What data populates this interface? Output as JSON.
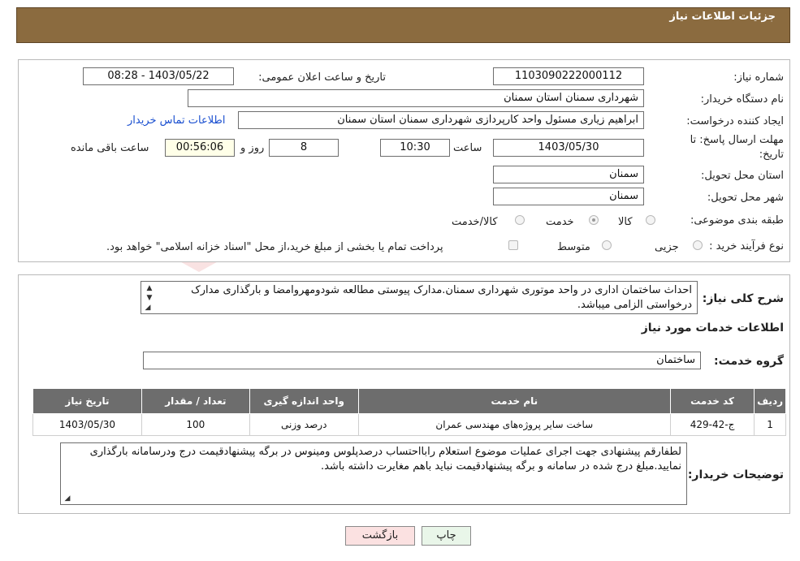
{
  "header": {
    "title": "جزئیات اطلاعات نیاز"
  },
  "fields": {
    "need_number_label": "شماره نیاز:",
    "need_number": "1103090222000112",
    "announce_label": "تاریخ و ساعت اعلان عمومی:",
    "announce_value": "1403/05/22 - 08:28",
    "buyer_org_label": "نام دستگاه خریدار:",
    "buyer_org": "شهرداری سمنان استان سمنان",
    "creator_label": "ایجاد کننده درخواست:",
    "creator": "ابراهیم زیاری مسئول واحد کارپردازی شهرداری سمنان استان سمنان",
    "contact_link": "اطلاعات تماس خریدار",
    "deadline_label_1": "مهلت ارسال پاسخ: تا",
    "deadline_label_2": "تاریخ:",
    "deadline_date": "1403/05/30",
    "hour_label": "ساعت",
    "deadline_time": "10:30",
    "days_value": "8",
    "days_label": "روز و",
    "remaining_time": "00:56:06",
    "remaining_label": "ساعت باقی مانده",
    "province_label": "استان محل تحویل:",
    "province": "سمنان",
    "city_label": "شهر محل تحویل:",
    "city": "سمنان",
    "category_label": "طبقه بندی موضوعی:",
    "category_options": [
      "کالا",
      "خدمت",
      "کالا/خدمت"
    ],
    "purchase_type_label": "نوع فرآیند خرید :",
    "purchase_options": [
      "جزیی",
      "متوسط"
    ],
    "payment_note": "پرداخت تمام یا بخشی از مبلغ خرید،از محل \"اسناد خزانه اسلامی\" خواهد بود."
  },
  "summary": {
    "label": "شرح کلی نیاز:",
    "text": "احداث ساختمان اداری در واحد موتوری شهرداری سمنان.مدارک پیوستی مطالعه شودومهروامضا و بارگذاری مدارک درخواستی الزامی میباشد."
  },
  "services": {
    "section_title": "اطلاعات خدمات مورد نیاز",
    "group_label": "گروه خدمت:",
    "group_value": "ساختمان",
    "table_headers": [
      "ردیف",
      "کد خدمت",
      "نام خدمت",
      "واحد اندازه گیری",
      "تعداد / مقدار",
      "تاریخ نیاز"
    ],
    "rows": [
      {
        "index": "1",
        "code": "ج-42-429",
        "name": "ساخت سایر پروژه‌های مهندسی عمران",
        "unit": "درصد وزنی",
        "qty": "100",
        "date": "1403/05/30"
      }
    ]
  },
  "buyer_notes": {
    "label": "توضیحات خریدار:",
    "text": "لطفارقم پیشنهادی جهت اجرای عملیات موضوع استعلام رابااحتساب درصدپلوس ومینوس در برگه پیشنهادقیمت درج ودرسامانه بارگذاری نمایید.مبلغ درج شده در سامانه و برگه پیشنهادقیمت نباید باهم مغایرت داشته باشد."
  },
  "buttons": {
    "print": "چاپ",
    "back": "بازگشت"
  },
  "watermark": {
    "text": "AriaTender.neT"
  },
  "colors": {
    "header_bg": "#8b6b3f",
    "table_header_bg": "#6d6d6d",
    "link": "#1a4fd0"
  }
}
